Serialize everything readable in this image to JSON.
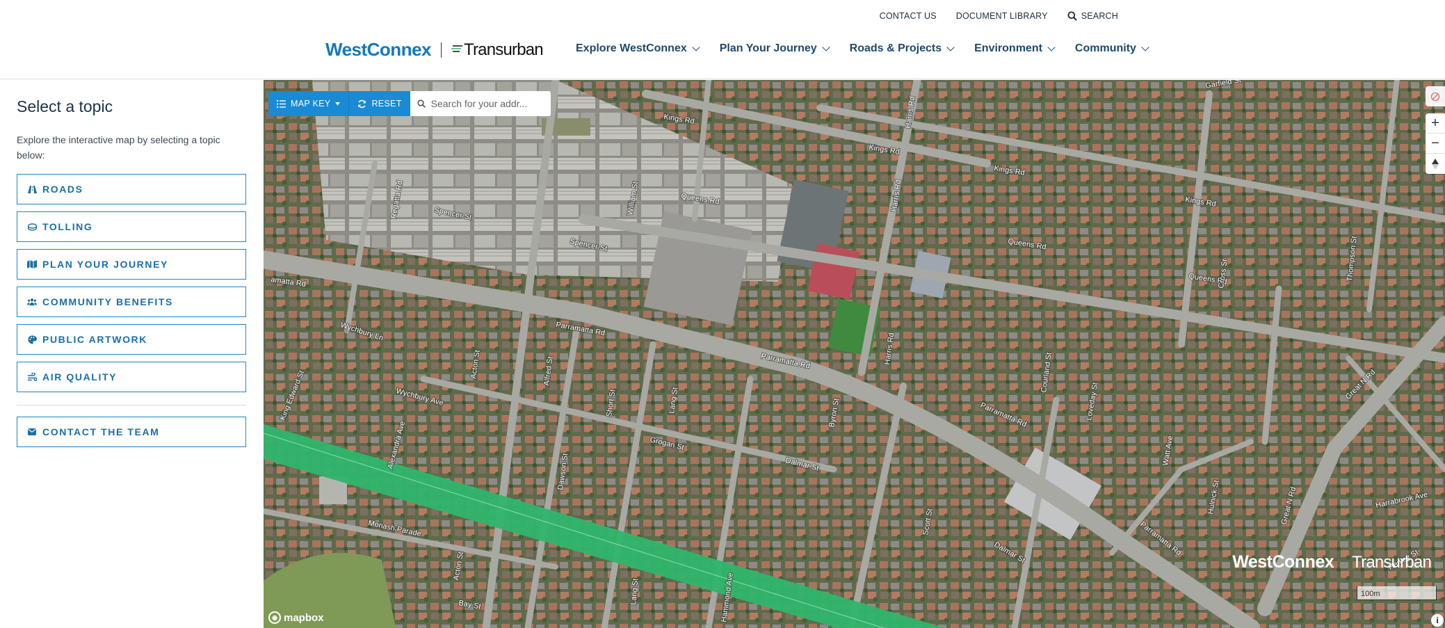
{
  "header": {
    "utility": {
      "contact": "CONTACT US",
      "library": "DOCUMENT LIBRARY",
      "search": "SEARCH"
    },
    "logo": {
      "primary": "WestConnex",
      "secondary": "Transurban"
    },
    "nav": [
      "Explore WestConnex",
      "Plan Your Journey",
      "Roads & Projects",
      "Environment",
      "Community"
    ]
  },
  "sidebar": {
    "title": "Select a topic",
    "intro": "Explore the interactive map by selecting a topic below:",
    "topics": [
      {
        "label": "ROADS",
        "icon": "road-icon"
      },
      {
        "label": "TOLLING",
        "icon": "toll-icon"
      },
      {
        "label": "PLAN YOUR JOURNEY",
        "icon": "map-icon"
      },
      {
        "label": "COMMUNITY BENEFITS",
        "icon": "people-icon"
      },
      {
        "label": "PUBLIC ARTWORK",
        "icon": "palette-icon"
      },
      {
        "label": "AIR QUALITY",
        "icon": "wind-icon"
      }
    ],
    "contact": {
      "label": "CONTACT THE TEAM",
      "icon": "envelope-icon"
    }
  },
  "map": {
    "toolbar": {
      "map_key": "MAP KEY",
      "reset": "RESET",
      "search_placeholder": "Search for your addr..."
    },
    "zoom": {
      "in": "+",
      "out": "−"
    },
    "scale": "100m",
    "attribution": "mapbox",
    "watermark": {
      "primary": "WestConnex",
      "secondary": "Transurban"
    },
    "colors": {
      "motorway": "#2fb56b",
      "accent": "#1a8ad4"
    },
    "streets": [
      "Garfield St",
      "Kings Rd",
      "Harris Rd",
      "Queens Rd",
      "Regatta Rd",
      "Spencer St",
      "William St",
      "Parramatta Rd",
      "Wychbury Ln",
      "Wychbury Ave",
      "Acton St",
      "Alfred St",
      "Short St",
      "Lang St",
      "Byron St",
      "Courland St",
      "Loveday St",
      "Thompson St",
      "Cross St",
      "Great N Rd",
      "Dalmar St",
      "Grogan St",
      "Dawson St",
      "Alexandra Ave",
      "King Edward St",
      "Monash Parade",
      "Bay St",
      "Scott St",
      "Hammond Ave",
      "Hulnick St",
      "Harrabrook Ave",
      "Henley St",
      "Watt Ave"
    ]
  }
}
